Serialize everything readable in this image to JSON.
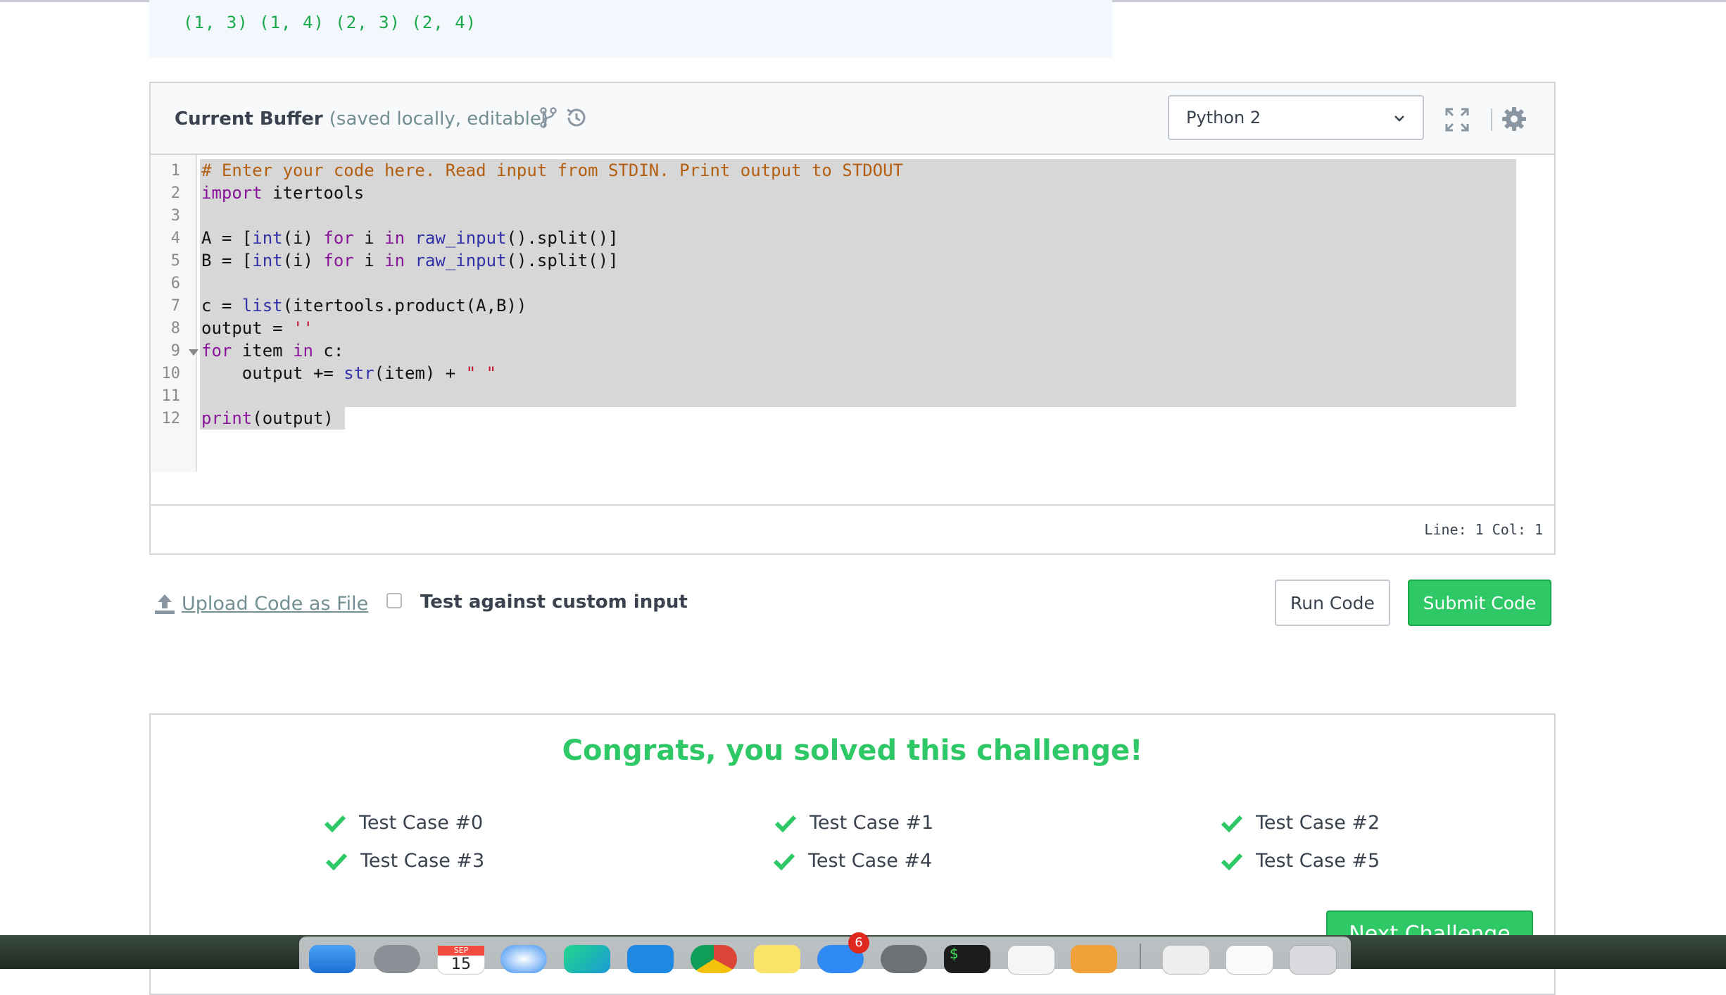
{
  "top_output": "(1, 3) (1, 4) (2, 3) (2, 4)",
  "editor": {
    "title": "Current Buffer",
    "subtitle": "(saved locally, editable)",
    "language": "Python 2",
    "status": "Line: 1 Col: 1",
    "line_numbers": [
      "1",
      "2",
      "3",
      "4",
      "5",
      "6",
      "7",
      "8",
      "9",
      "10",
      "11",
      "12"
    ]
  },
  "actions": {
    "upload_label": "Upload Code as File",
    "custom_input_label": "Test against custom input",
    "run_label": "Run Code",
    "submit_label": "Submit Code"
  },
  "result": {
    "title": "Congrats, you solved this challenge!",
    "test_cases": [
      "Test Case #0",
      "Test Case #1",
      "Test Case #2",
      "Test Case #3",
      "Test Case #4",
      "Test Case #5"
    ],
    "next_label": "Next Challenge"
  },
  "dock": {
    "calendar_month": "SEP",
    "calendar_day": "15",
    "appstore_badge": "6",
    "terminal_prompt": "$"
  },
  "colors": {
    "success": "#2ec866",
    "comment": "#b45e10",
    "keyword": "#8a159c",
    "builtin": "#3131a8"
  }
}
